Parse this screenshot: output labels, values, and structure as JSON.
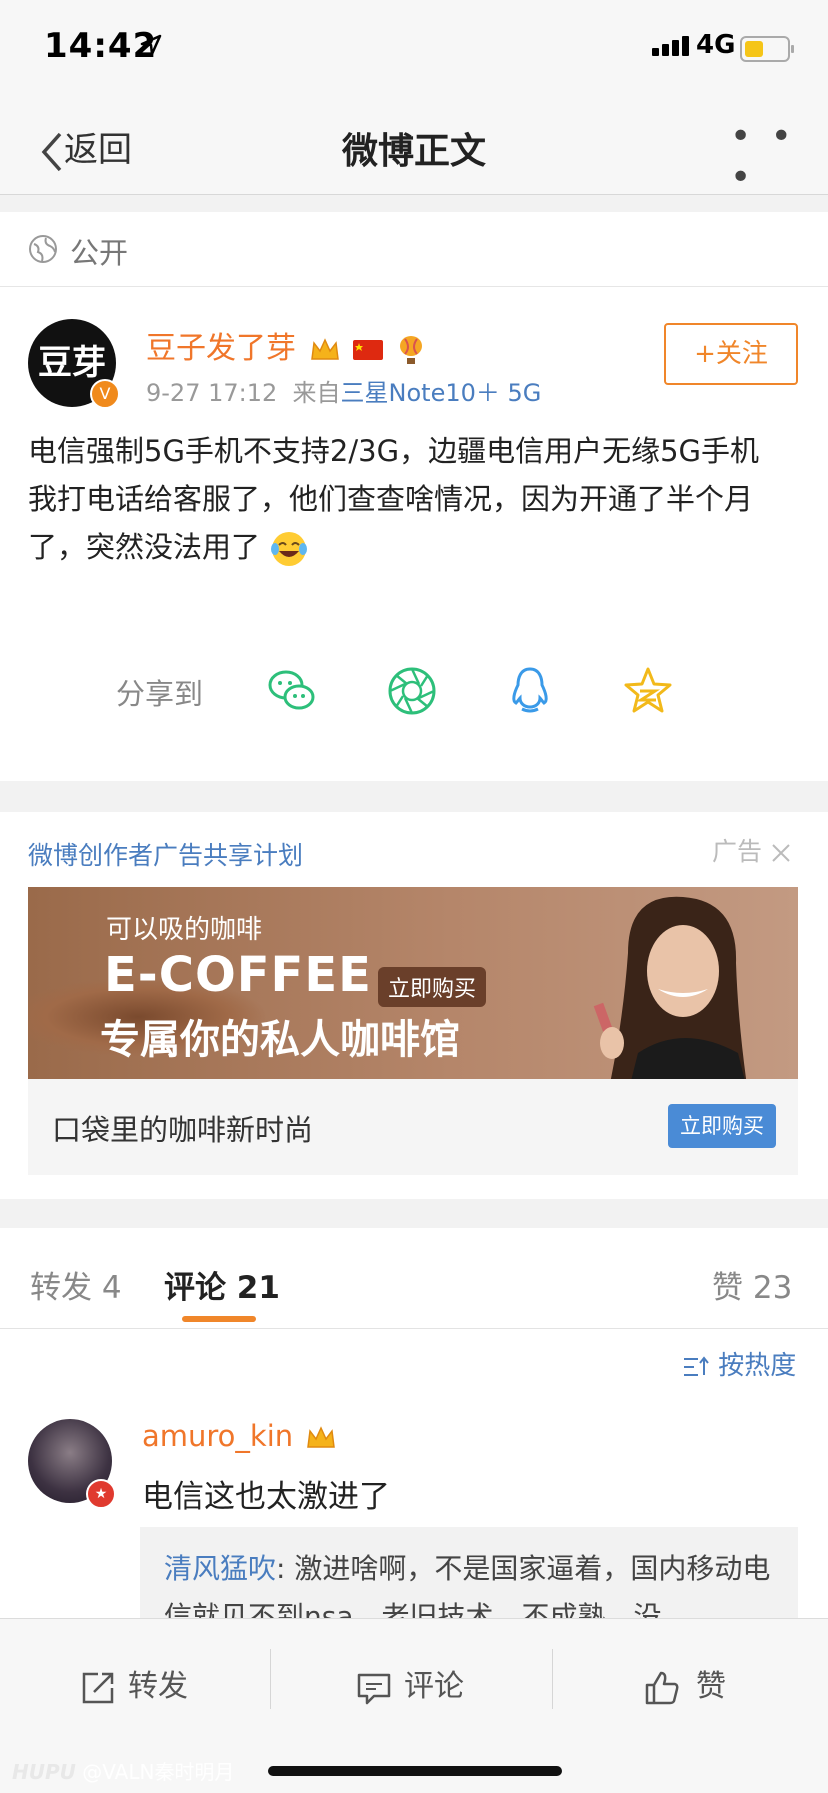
{
  "status_bar": {
    "time": "14:42",
    "network": "4G"
  },
  "nav": {
    "back_label": "返回",
    "title": "微博正文",
    "more_label": "• • •"
  },
  "visibility": {
    "label": "公开"
  },
  "post": {
    "avatar_text": "豆芽",
    "verified_badge": "V",
    "author": "豆子发了芽",
    "time": "9-27 17:12",
    "source_prefix": "来自",
    "source": "三星Note10＋ 5G",
    "follow_label": "+关注",
    "text_line1": "电信强制5G手机不支持2/3G，边疆电信用户无缘5G手机",
    "text_line2": "我打电话给客服了，他们查查啥情况，因为开通了半个月了，突然没法用了",
    "share_label": "分享到",
    "share_icons": [
      "wechat-icon",
      "moments-icon",
      "qq-icon",
      "qzone-icon"
    ]
  },
  "ad": {
    "title": "微博创作者广告共享计划",
    "tag": "广告",
    "banner_line1": "可以吸的咖啡",
    "banner_brand": "E-COFFEE",
    "banner_buy": "立即购买",
    "banner_slogan": "专属你的私人咖啡馆",
    "footer_text": "口袋里的咖啡新时尚",
    "footer_button": "立即购买"
  },
  "tabs": {
    "repost": "转发 4",
    "comment": "评论 21",
    "like": "赞 23"
  },
  "comments": {
    "sort_label": "按热度",
    "items": [
      {
        "name": "amuro_kin",
        "text": "电信这也太激进了",
        "reply_author": "清风猛吹",
        "reply_text": ": 激进啥啊，不是国家逼着，国内移动电信就见不到nsa，老旧技术，不成熟，没"
      }
    ]
  },
  "bottom_bar": {
    "repost": "转发",
    "comment": "评论",
    "like": "赞"
  },
  "watermark": {
    "brand": "HUPU",
    "user": "@VALN秦时明月"
  },
  "colors": {
    "accent_orange": "#f0862a",
    "link_blue": "#4a7dbf"
  }
}
